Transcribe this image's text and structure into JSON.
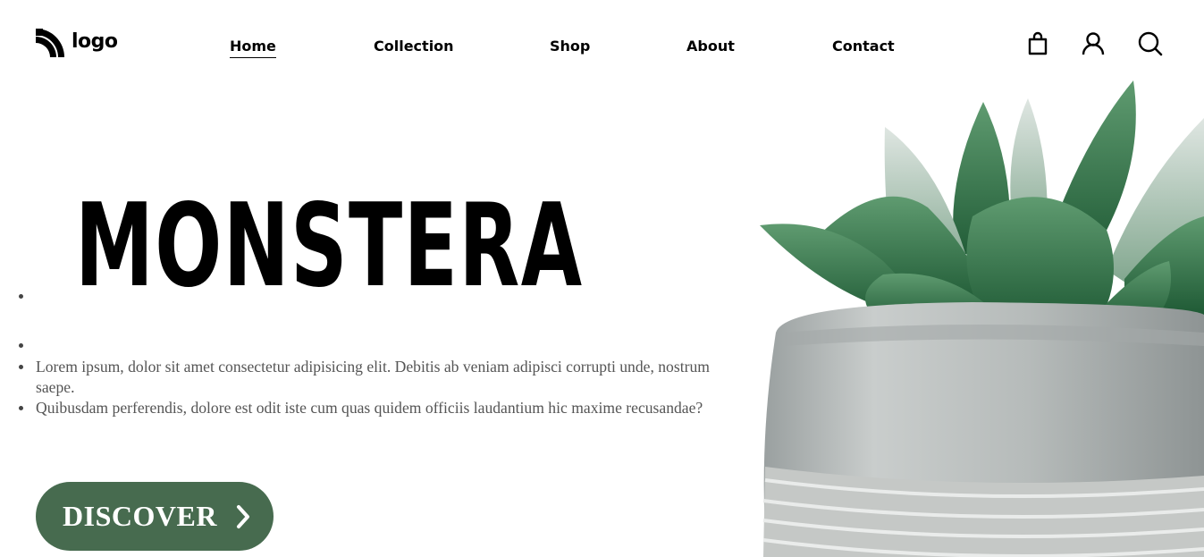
{
  "brand": {
    "name": "logo",
    "icon": "rss-icon"
  },
  "nav": {
    "items": [
      {
        "label": "Home",
        "active": true
      },
      {
        "label": "Collection",
        "active": false
      },
      {
        "label": "Shop",
        "active": false
      },
      {
        "label": "About",
        "active": false
      },
      {
        "label": "Contact",
        "active": false
      }
    ]
  },
  "header_icons": [
    "shopping-bag-icon",
    "user-icon",
    "search-icon"
  ],
  "hero": {
    "title": "MONSTERA",
    "paragraphs": [
      "Lorem ipsum, dolor sit amet consectetur adipisicing elit. Debitis ab veniam adipisci corrupti unde, nostrum saepe.",
      "Quibusdam perferendis, dolore est odit iste cum quas quidem officiis laudantium hic maxime recusandae?"
    ],
    "cta_label": "DISCOVER",
    "cta_icon": "chevron-right-icon",
    "image": "succulent-plant-in-concrete-pot"
  },
  "colors": {
    "accent": "#476b4f",
    "text": "#000000",
    "muted_text": "#555555",
    "background": "#ffffff"
  }
}
